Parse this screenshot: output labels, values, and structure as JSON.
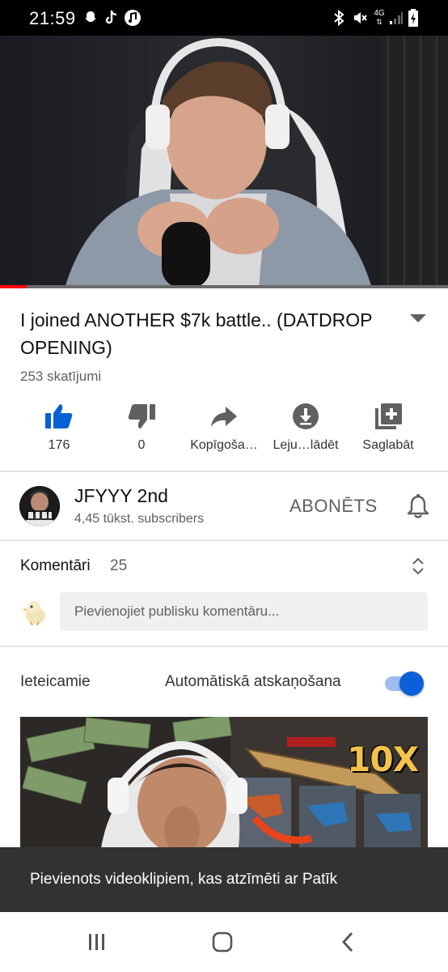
{
  "status_bar": {
    "time": "21:59",
    "network": "4G",
    "icons": [
      "snapchat-icon",
      "tiktok-icon",
      "music-app-icon",
      "bluetooth-icon",
      "mute-icon",
      "network-4g-icon",
      "signal-icon",
      "battery-charging-icon"
    ]
  },
  "player": {
    "progress_percent": 6
  },
  "video": {
    "title": "I joined ANOTHER $7k battle.. (DATDROP OPENING)",
    "views": "253 skatījumi"
  },
  "actions": [
    {
      "name": "like-button",
      "icon": "thumbs-up-icon",
      "label": "176"
    },
    {
      "name": "dislike-button",
      "icon": "thumbs-down-icon",
      "label": "0"
    },
    {
      "name": "share-button",
      "icon": "share-icon",
      "label": "Kopīgoša…"
    },
    {
      "name": "download-button",
      "icon": "download-icon",
      "label": "Leju…lādēt"
    },
    {
      "name": "save-button",
      "icon": "playlist-add-icon",
      "label": "Saglabāt"
    }
  ],
  "channel": {
    "name": "JFYYY 2nd",
    "subscribers": "4,45 tūkst. subscribers",
    "subscribe_label": "ABONĒTS"
  },
  "comments": {
    "title": "Komentāri",
    "count": "25",
    "placeholder": "Pievienojiet publisku komentāru..."
  },
  "recommendations": {
    "title": "Ieteicamie",
    "autoplay_label": "Automātiskā atskaņošana",
    "autoplay_on": true,
    "thumbnail_badge": "10X"
  },
  "snackbar": {
    "text": "Pievienots videoklipiem, kas atzīmēti ar Patīk"
  },
  "colors": {
    "accent_blue": "#065fd4",
    "progress_red": "#ff0000",
    "toggle_knob": "#0b5fd9"
  }
}
